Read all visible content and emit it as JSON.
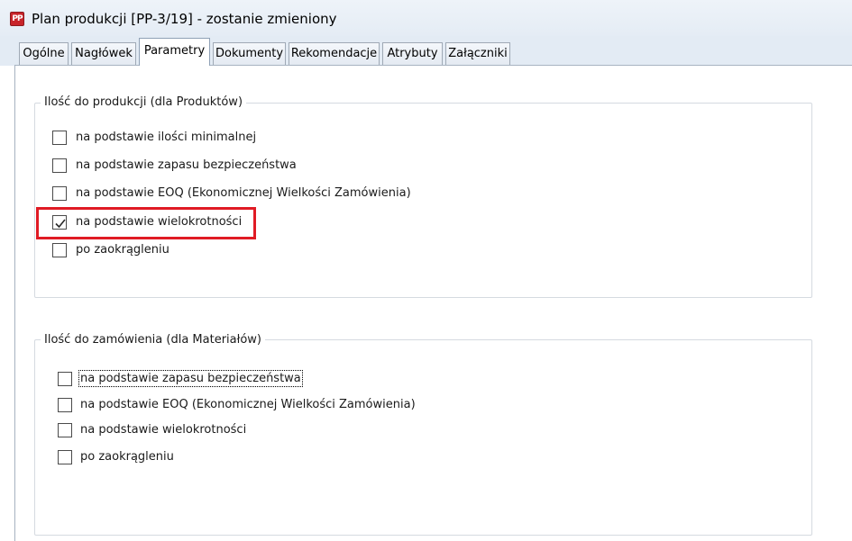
{
  "window": {
    "icon_text": "PP",
    "title": "Plan produkcji [PP-3/19] - zostanie zmieniony"
  },
  "tabs": [
    {
      "label": "Ogólne",
      "active": false
    },
    {
      "label": "Nagłówek",
      "active": false
    },
    {
      "label": "Parametry",
      "active": true
    },
    {
      "label": "Dokumenty",
      "active": false
    },
    {
      "label": "Rekomendacje",
      "active": false
    },
    {
      "label": "Atrybuty",
      "active": false
    },
    {
      "label": "Załączniki",
      "active": false
    }
  ],
  "groups": [
    {
      "title": "Ilość do produkcji (dla Produktów)",
      "options": [
        {
          "label": "na podstawie ilości minimalnej",
          "checked": false
        },
        {
          "label": "na podstawie zapasu bezpieczeństwa",
          "checked": false
        },
        {
          "label": "na podstawie EOQ (Ekonomicznej Wielkości Zamówienia)",
          "checked": false
        },
        {
          "label": "na podstawie wielokrotności",
          "checked": true,
          "highlighted": true
        },
        {
          "label": "po zaokrągleniu",
          "checked": false
        }
      ]
    },
    {
      "title": "Ilość do zamówienia (dla Materiałów)",
      "options": [
        {
          "label": "na podstawie zapasu bezpieczeństwa",
          "checked": false,
          "focused": true
        },
        {
          "label": "na podstawie EOQ (Ekonomicznej Wielkości Zamówienia)",
          "checked": false
        },
        {
          "label": "na podstawie wielokrotności",
          "checked": false
        },
        {
          "label": "po zaokrągleniu",
          "checked": false
        }
      ]
    }
  ],
  "colors": {
    "highlight": "#e01b24",
    "app_icon": "#c8242a"
  }
}
